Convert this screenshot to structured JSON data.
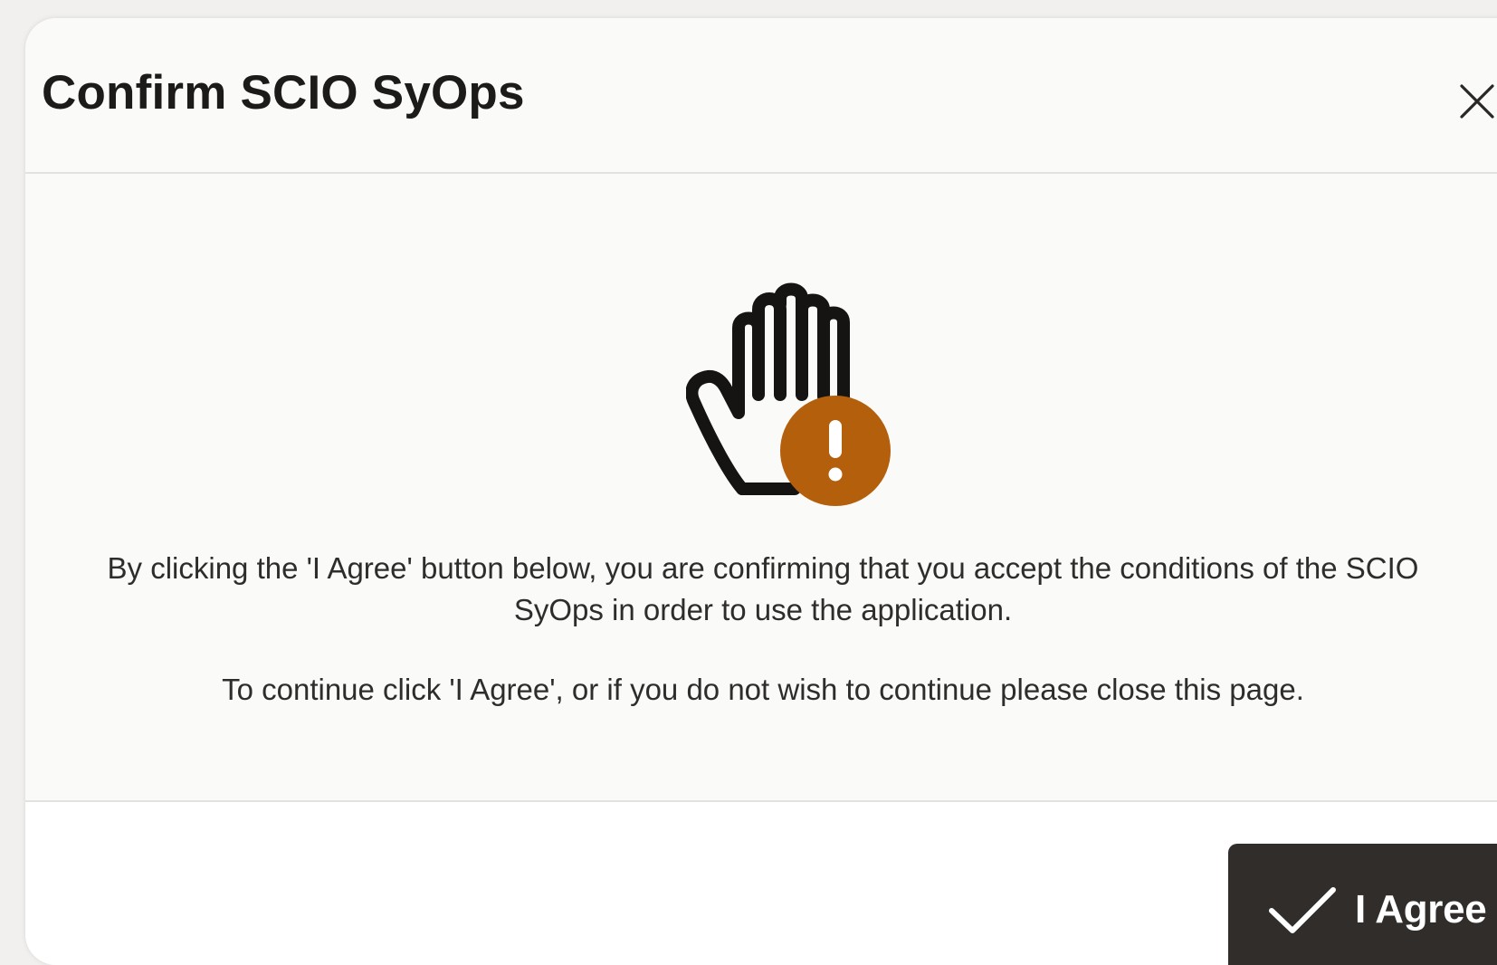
{
  "dialog": {
    "title": "Confirm SCIO SyOps",
    "close_icon": "close-icon",
    "icon": "raised-hand-warning-icon",
    "accent_color": "#b35f0c",
    "message_1": "By clicking the 'I Agree' button below, you are confirming that you accept the conditions of the SCIO SyOps in order to use the application.",
    "message_2": "To continue click 'I Agree', or if you do not wish to continue please close this page.",
    "agree_button": {
      "label": "I Agree",
      "icon": "checkmark-icon",
      "color": "#312d2a"
    }
  }
}
